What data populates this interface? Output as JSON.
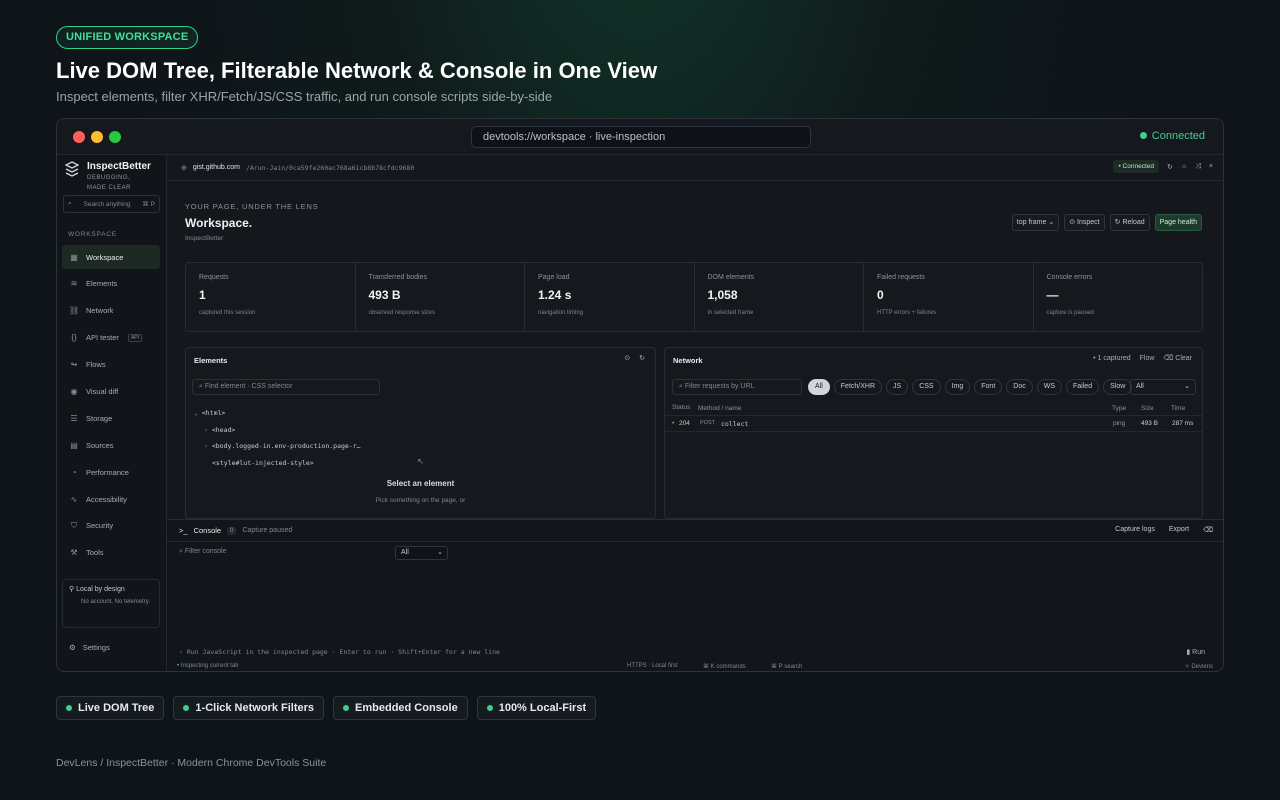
{
  "hero": {
    "badge": "UNIFIED WORKSPACE",
    "title": "Live DOM Tree, Filterable Network & Console in One View",
    "subtitle": "Inspect elements, filter XHR/Fetch/JS/CSS traffic, and run console scripts side-by-side"
  },
  "window": {
    "url": "devtools://workspace · live-inspection",
    "status": "Connected"
  },
  "sidebar": {
    "app_name": "InspectBetter",
    "tagline_1": "DEBUGGING,",
    "tagline_2": "MADE CLEAR",
    "search_placeholder": "Search anything",
    "search_shortcut": "⌘ P",
    "section": "WORKSPACE",
    "items": [
      {
        "label": "Workspace",
        "icon": "grid-icon"
      },
      {
        "label": "Elements",
        "icon": "layers-icon"
      },
      {
        "label": "Network",
        "icon": "network-icon"
      },
      {
        "label": "API tester",
        "icon": "braces-icon",
        "tag": "API"
      },
      {
        "label": "Flows",
        "icon": "flow-icon"
      },
      {
        "label": "Visual diff",
        "icon": "eye-icon"
      },
      {
        "label": "Storage",
        "icon": "database-icon"
      },
      {
        "label": "Sources",
        "icon": "file-icon"
      },
      {
        "label": "Performance",
        "icon": "gauge-icon"
      },
      {
        "label": "Accessibility",
        "icon": "pulse-icon"
      },
      {
        "label": "Security",
        "icon": "shield-icon"
      },
      {
        "label": "Tools",
        "icon": "wrench-icon"
      }
    ],
    "local_title": "Local by design",
    "local_sub": "No account. No telemetry.",
    "settings": "Settings"
  },
  "topbar": {
    "host": "gist.github.com",
    "path": "/Arun-Jain/0ca59fe260ac768a61cb8b78cfdc9680",
    "status": "Connected"
  },
  "workspace": {
    "pretitle": "YOUR PAGE, UNDER THE LENS",
    "title": "Workspace.",
    "subtitle": "InspectBetter",
    "frame_select": "top frame",
    "inspect": "Inspect",
    "reload": "Reload",
    "health": "Page health"
  },
  "stats": [
    {
      "label": "Requests",
      "value": "1",
      "sub": "captured this session"
    },
    {
      "label": "Transferred bodies",
      "value": "493 B",
      "sub": "observed response sizes"
    },
    {
      "label": "Page load",
      "value": "1.24 s",
      "sub": "navigation timing"
    },
    {
      "label": "DOM elements",
      "value": "1,058",
      "sub": "in selected frame"
    },
    {
      "label": "Failed requests",
      "value": "0",
      "sub": "HTTP errors + failures"
    },
    {
      "label": "Console errors",
      "value": "—",
      "sub": "capture is paused"
    }
  ],
  "elements": {
    "title": "Elements",
    "find_placeholder": "Find element · CSS selector",
    "tree": [
      "<html>",
      "<head>",
      "<body.logged-in.env-production.page-r…",
      "<style#lut-injected-style>"
    ],
    "empty_title": "Select an element",
    "empty_sub": "Pick something on the page, or"
  },
  "network": {
    "title": "Network",
    "captured": "1 captured",
    "flow": "Flow",
    "clear": "Clear",
    "filter_placeholder": "Filter requests by URL",
    "chips": [
      "All",
      "Fetch/XHR",
      "JS",
      "CSS",
      "Img",
      "Font",
      "Doc",
      "WS",
      "Failed",
      "Slow"
    ],
    "select": "All",
    "columns": {
      "status": "Status",
      "method": "Method / name",
      "type": "Type",
      "size": "Size",
      "time": "Time"
    },
    "rows": [
      {
        "status": "204",
        "method": "POST",
        "name": "collect",
        "type": "ping",
        "size": "493 B",
        "time": "287 ms"
      }
    ]
  },
  "console": {
    "title": "Console",
    "count": "0",
    "paused": "Capture paused",
    "capture_logs": "Capture logs",
    "export": "Export",
    "filter_placeholder": "Filter console",
    "level": "All",
    "prompt": "Run JavaScript in the inspected page · Enter to run · Shift+Enter for a new line",
    "run": "Run"
  },
  "statusbar": {
    "left": "Inspecting current tab",
    "mid1": "HTTPS · Local first",
    "mid2": "⌘ K commands",
    "mid3": "⌘ P search",
    "right": "Devlens"
  },
  "features": [
    "Live DOM Tree",
    "1-Click Network Filters",
    "Embedded Console",
    "100% Local-First"
  ],
  "footer": "DevLens / InspectBetter · Modern Chrome DevTools Suite"
}
